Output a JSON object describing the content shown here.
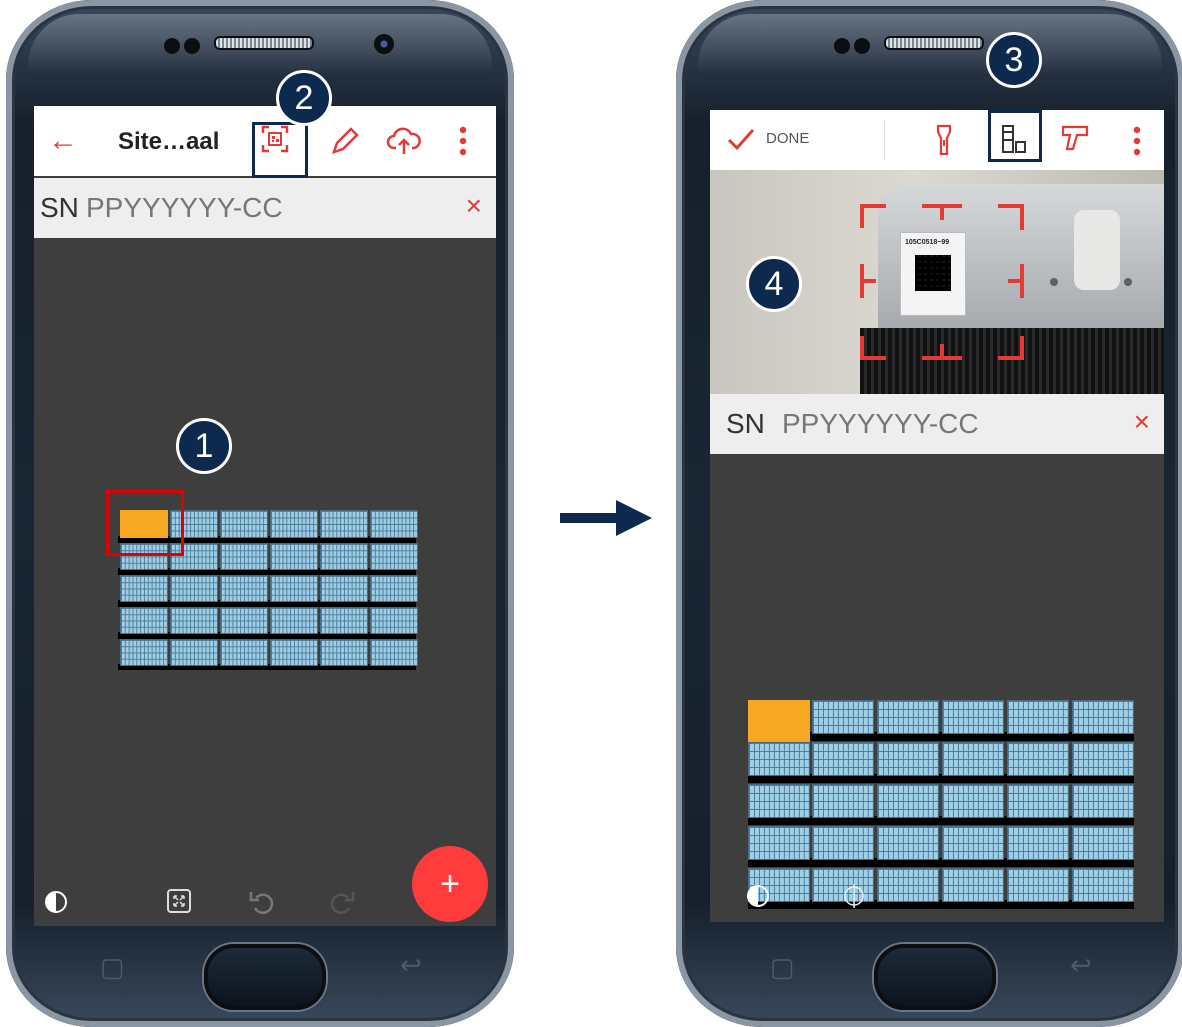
{
  "left": {
    "toolbar": {
      "title": "Site…aal"
    },
    "sn": {
      "prefix": "SN",
      "value": "PPYYYYYY-CC",
      "clear": "×"
    },
    "fab": "+"
  },
  "right": {
    "toolbar": {
      "done": "DONE"
    },
    "camera_label": "105C0518−99",
    "sn": {
      "prefix": "SN",
      "value": "PPYYYYYY-CC",
      "clear": "×"
    }
  },
  "callouts": [
    "1",
    "2",
    "3",
    "4"
  ],
  "colors": {
    "accent": "#e53935",
    "panel": "#9ecfe6",
    "selected_panel": "#f7a823",
    "callout": "#0d2a4e"
  },
  "icons": [
    "back-arrow-icon",
    "barcode-scan-icon",
    "pencil-icon",
    "cloud-upload-icon",
    "more-vert-icon",
    "check-icon",
    "flashlight-icon",
    "scanner-mode-icon",
    "barcode-gun-icon",
    "contrast-icon",
    "fit-screen-icon",
    "undo-icon",
    "redo-icon"
  ]
}
